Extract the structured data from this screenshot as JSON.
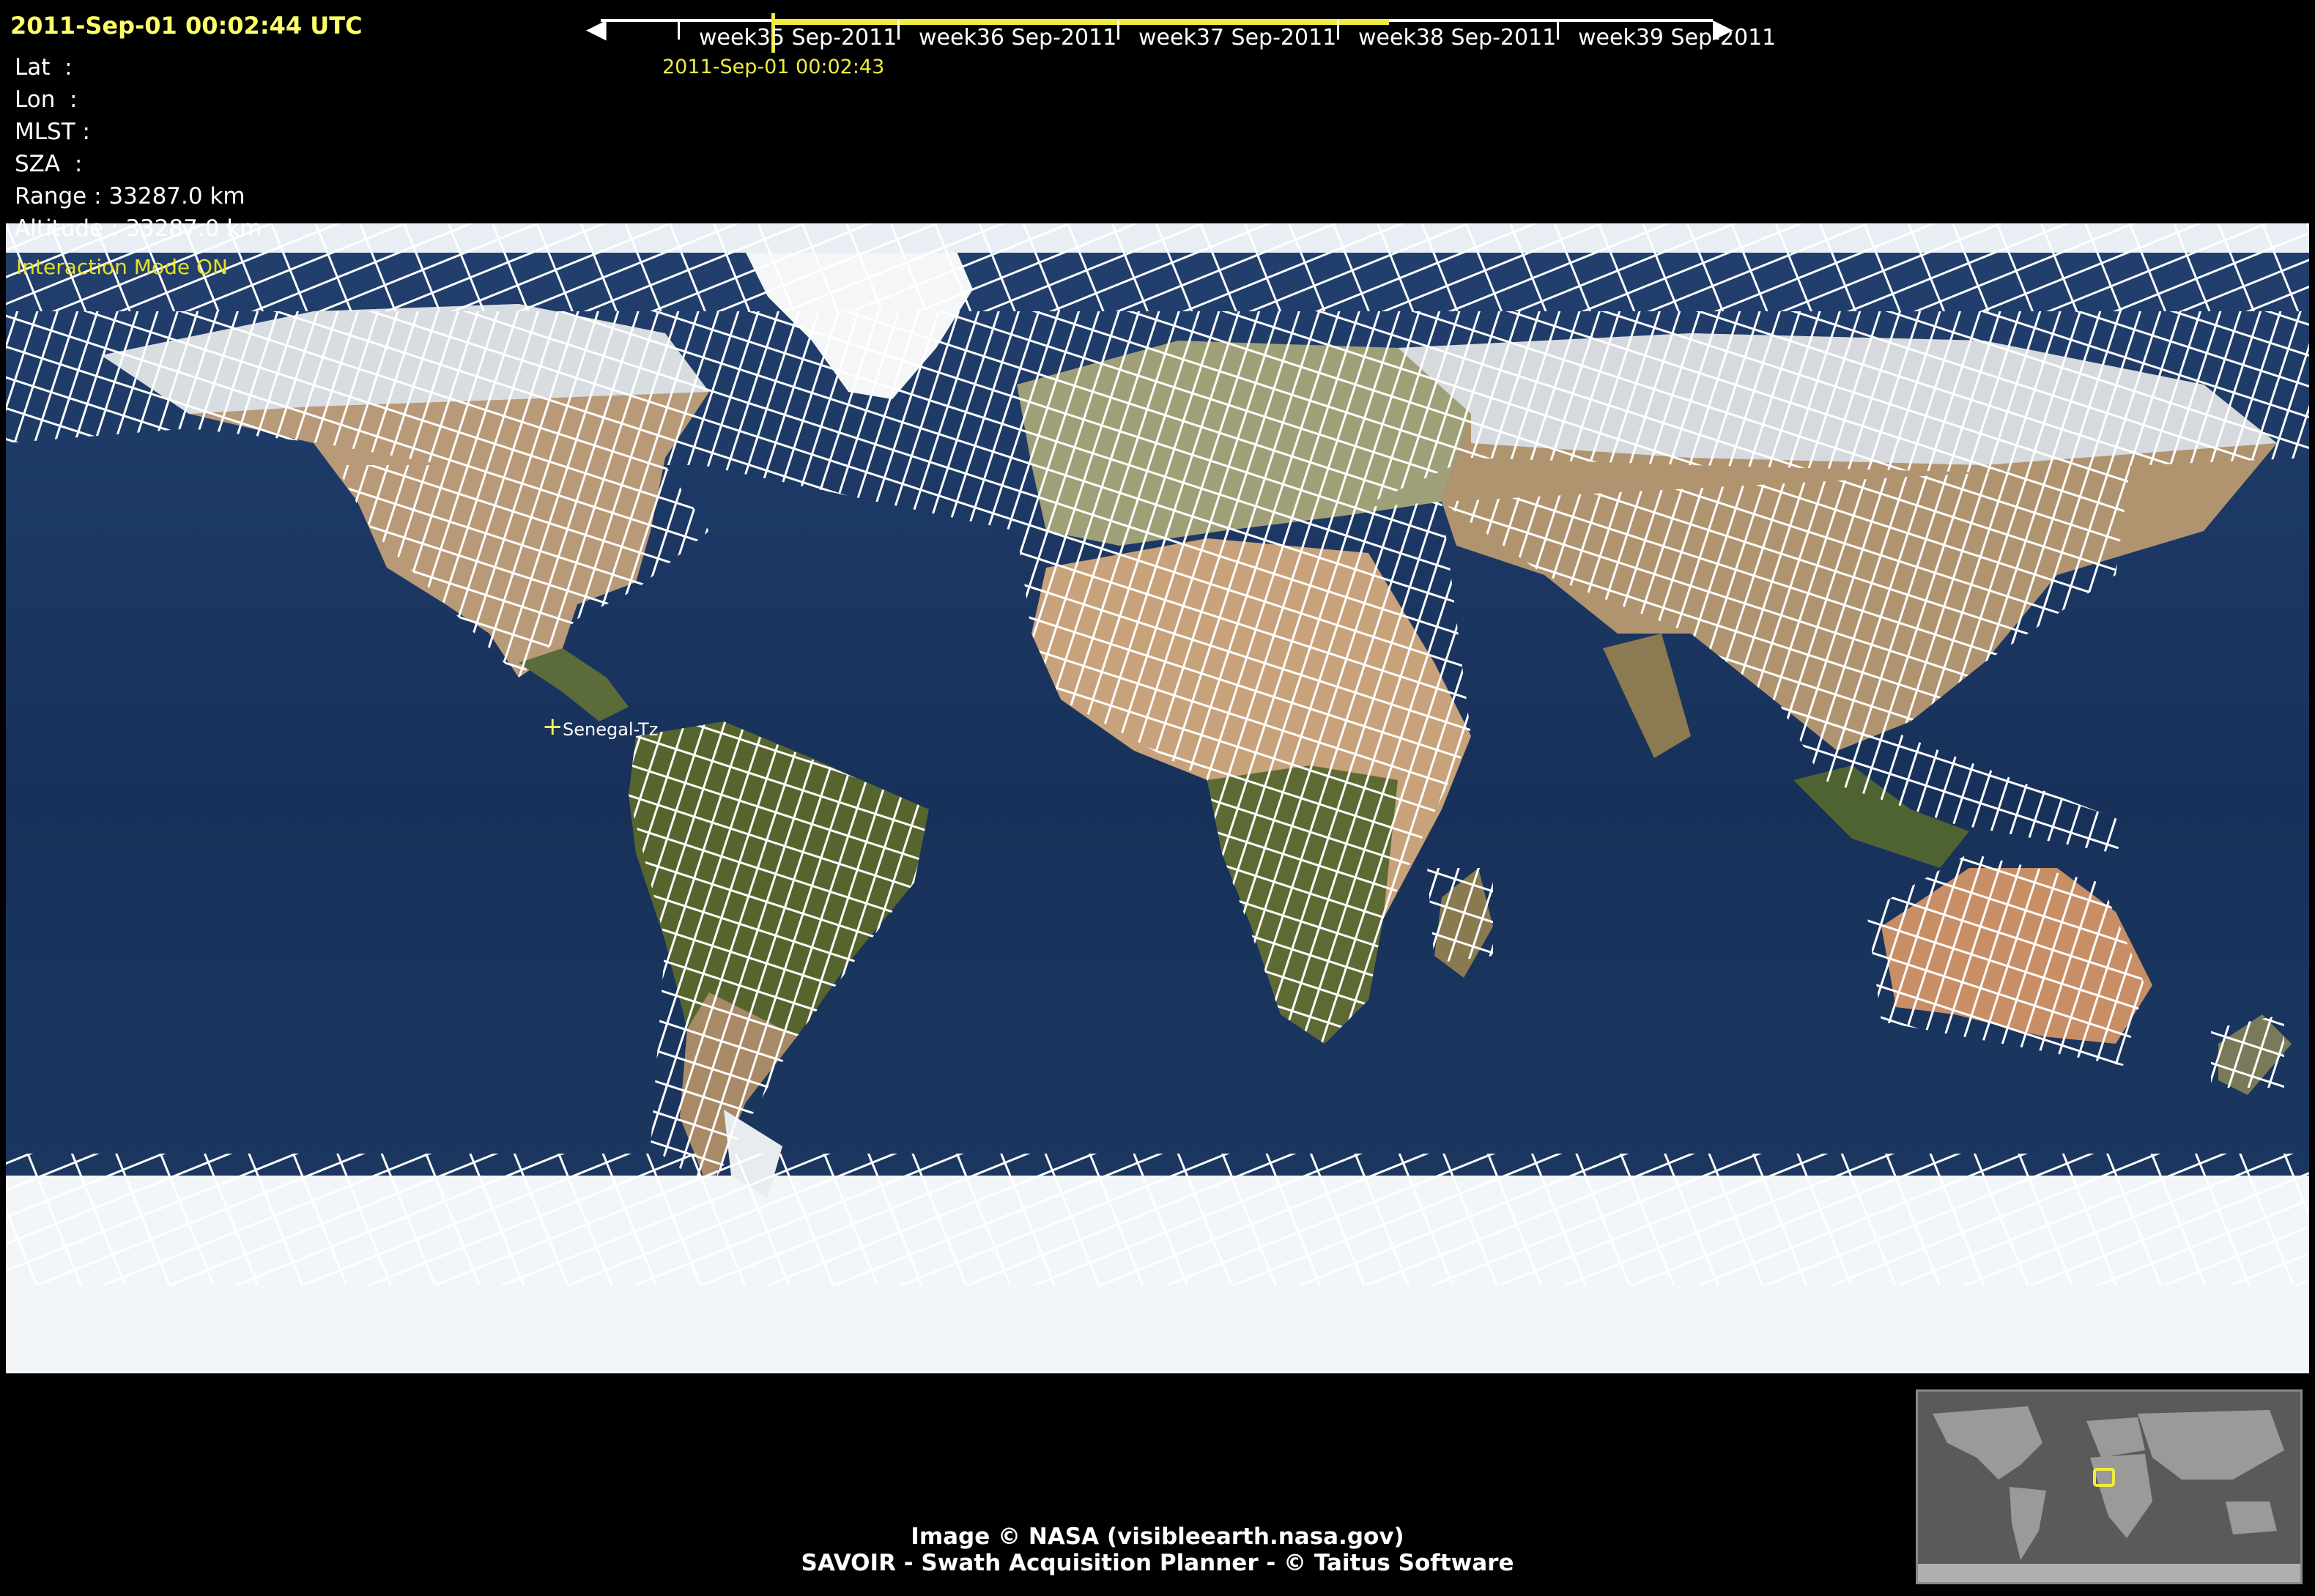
{
  "header": {
    "datetime": "2011-Sep-01 00:02:44 UTC",
    "lat": "Lat  :",
    "lon": "Lon  :",
    "mlst": "MLST :",
    "sza": "SZA  :",
    "range": "Range : 33287.0 km",
    "altitude": "Altitude : 33287.0 km",
    "interaction_mode": "Interaction Mode ON"
  },
  "timeline": {
    "current_time": "2011-Sep-01 00:02:43",
    "weeks": [
      "week35 Sep-2011",
      "week36 Sep-2011",
      "week37 Sep-2011",
      "week38 Sep-2011",
      "week39 Sep-2011"
    ],
    "range_color": "#f0ec40"
  },
  "map": {
    "target_label": "Senegal-Tz",
    "swath_color": "#ffffff",
    "ocean_color": "#1b3a66"
  },
  "credits": {
    "line1": "Image © NASA (visibleearth.nasa.gov)",
    "line2": "SAVOIR - Swath Acquisition Planner - © Taitus Software"
  },
  "overview": {
    "highlight_color": "#f0ec40"
  }
}
